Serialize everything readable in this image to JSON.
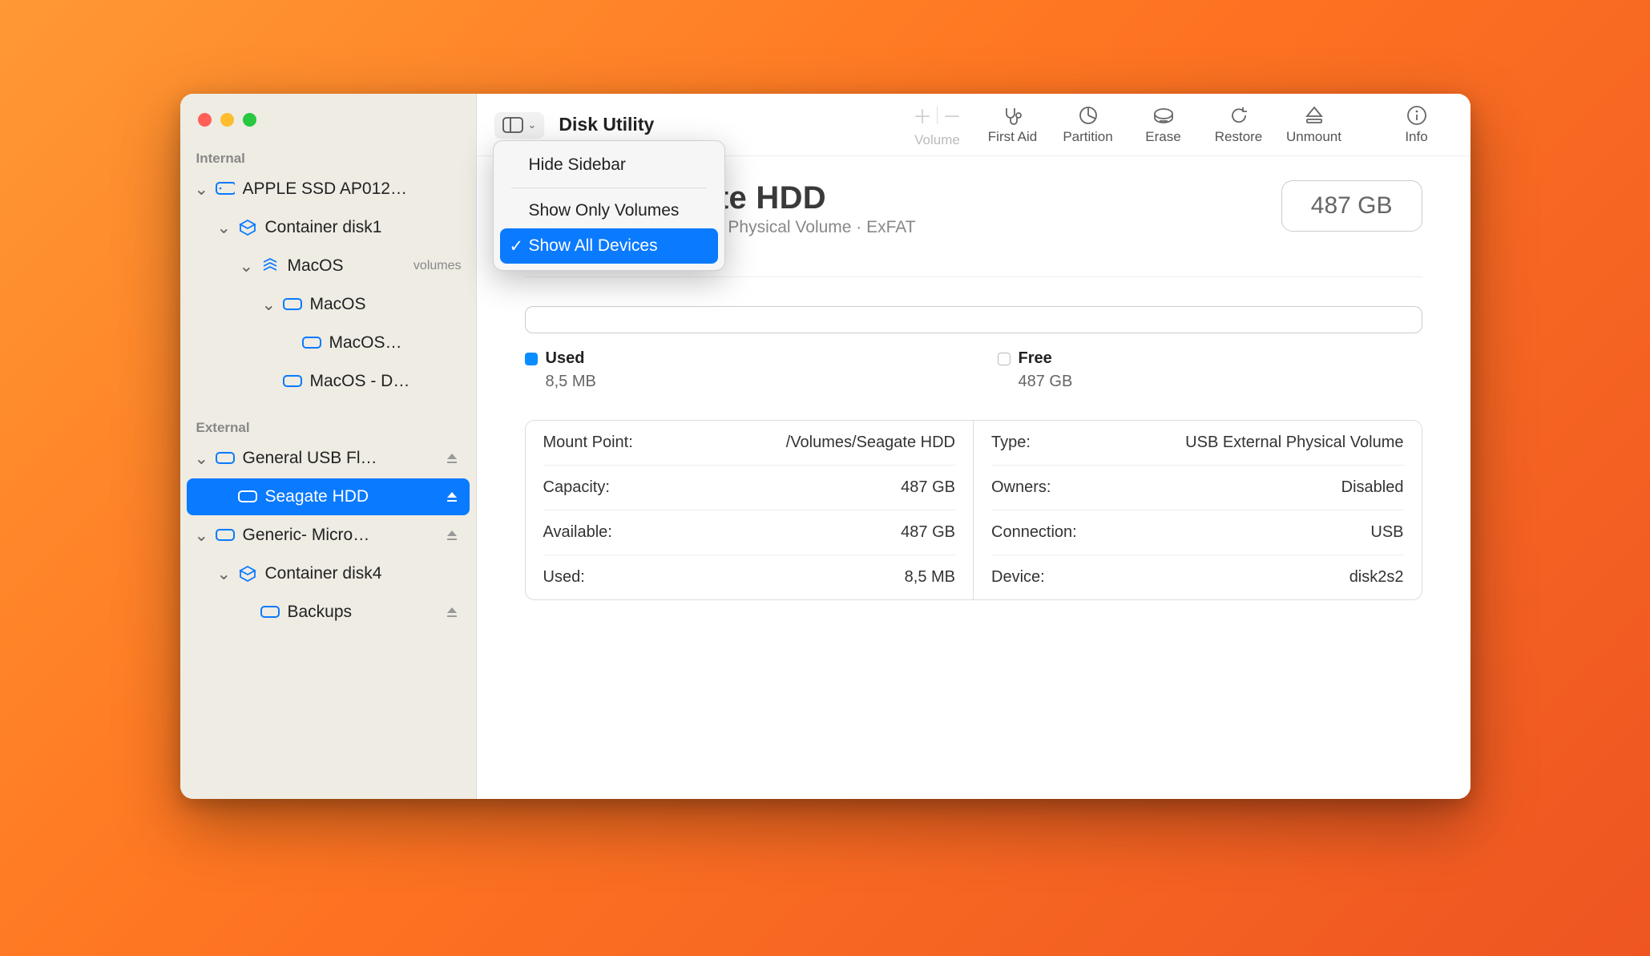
{
  "window": {
    "title": "Disk Utility"
  },
  "toolbar": {
    "volume_label": "Volume",
    "tools": [
      {
        "label": "First Aid"
      },
      {
        "label": "Partition"
      },
      {
        "label": "Erase"
      },
      {
        "label": "Restore"
      },
      {
        "label": "Unmount"
      }
    ],
    "info_label": "Info"
  },
  "sidebar_menu": {
    "hide": "Hide Sidebar",
    "only_volumes": "Show Only Volumes",
    "all_devices": "Show All Devices"
  },
  "sidebar": {
    "section_internal": "Internal",
    "section_external": "External",
    "internal": [
      {
        "label": "APPLE SSD AP012…"
      },
      {
        "label": "Container disk1"
      },
      {
        "label": "MacOS",
        "aux": "volumes"
      },
      {
        "label": "MacOS"
      },
      {
        "label": "MacOS…"
      },
      {
        "label": "MacOS - D…"
      }
    ],
    "external": [
      {
        "label": "General USB Fl…"
      },
      {
        "label": "Seagate HDD"
      },
      {
        "label": "Generic- Micro…"
      },
      {
        "label": "Container disk4"
      },
      {
        "label": "Backups"
      }
    ]
  },
  "hero": {
    "title": "Seagate HDD",
    "subtitle": "USB External Physical Volume · ExFAT",
    "capacity_pill": "487 GB"
  },
  "usage": {
    "used_label": "Used",
    "used_value": "8,5 MB",
    "free_label": "Free",
    "free_value": "487 GB"
  },
  "info": {
    "left": [
      {
        "k": "Mount Point:",
        "v": "/Volumes/Seagate HDD"
      },
      {
        "k": "Capacity:",
        "v": "487 GB"
      },
      {
        "k": "Available:",
        "v": "487 GB"
      },
      {
        "k": "Used:",
        "v": "8,5 MB"
      }
    ],
    "right": [
      {
        "k": "Type:",
        "v": "USB External Physical Volume"
      },
      {
        "k": "Owners:",
        "v": "Disabled"
      },
      {
        "k": "Connection:",
        "v": "USB"
      },
      {
        "k": "Device:",
        "v": "disk2s2"
      }
    ]
  }
}
